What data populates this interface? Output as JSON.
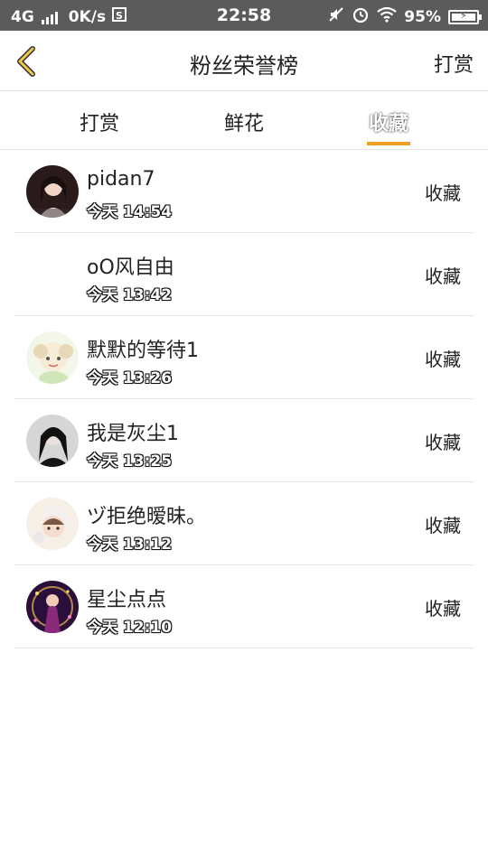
{
  "status_bar": {
    "network": "4G",
    "speed": "0K/s",
    "time": "22:58",
    "battery": "95%"
  },
  "header": {
    "title": "粉丝荣誉榜",
    "right_action": "打赏"
  },
  "tabs": [
    {
      "label": "打赏"
    },
    {
      "label": "鲜花"
    },
    {
      "label": "收藏"
    }
  ],
  "accent_color": "#f0a020",
  "list": [
    {
      "name": "pidan7",
      "time": "今天 14:54",
      "action": "收藏"
    },
    {
      "name": "oO风自由",
      "time": "今天 13:42",
      "action": "收藏"
    },
    {
      "name": "默默的等待1",
      "time": "今天 13:26",
      "action": "收藏"
    },
    {
      "name": "我是灰尘1",
      "time": "今天 13:25",
      "action": "收藏"
    },
    {
      "name": "ヅ拒绝暧昧。",
      "time": "今天 13:12",
      "action": "收藏"
    },
    {
      "name": "星尘点点",
      "time": "今天 12:10",
      "action": "收藏"
    }
  ]
}
